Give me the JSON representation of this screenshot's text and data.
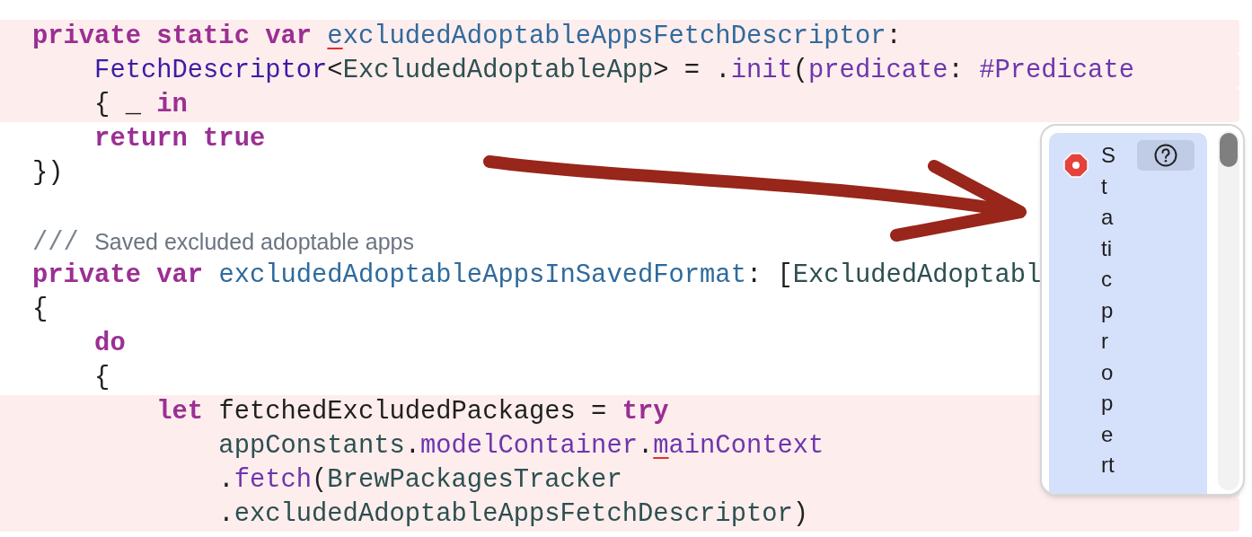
{
  "code_lines": [
    {
      "error": true,
      "tokens": [
        {
          "kind": "keyword",
          "text": "private static var "
        },
        {
          "kind": "decl-flag",
          "text": "e"
        },
        {
          "kind": "decl",
          "text": "xcludedAdoptableAppsFetchDescriptor"
        },
        {
          "kind": "plain",
          "text": ":"
        }
      ]
    },
    {
      "error": true,
      "tokens": [
        {
          "kind": "type",
          "text": "    FetchDescriptor"
        },
        {
          "kind": "plain",
          "text": "<"
        },
        {
          "kind": "project",
          "text": "ExcludedAdoptableApp"
        },
        {
          "kind": "plain",
          "text": "> = ."
        },
        {
          "kind": "member",
          "text": "init"
        },
        {
          "kind": "plain",
          "text": "("
        },
        {
          "kind": "member",
          "text": "predicate"
        },
        {
          "kind": "plain",
          "text": ": "
        },
        {
          "kind": "member",
          "text": "#Predicate"
        }
      ]
    },
    {
      "error": true,
      "tokens": [
        {
          "kind": "plain",
          "text": "    { _ "
        },
        {
          "kind": "keyword",
          "text": "in"
        }
      ]
    },
    {
      "error": false,
      "tokens": [
        {
          "kind": "keyword",
          "text": "    return true"
        }
      ]
    },
    {
      "error": false,
      "tokens": [
        {
          "kind": "plain",
          "text": "})"
        }
      ]
    },
    {
      "error": false
    },
    {
      "error": false,
      "tokens": [
        {
          "kind": "comment-marker",
          "text": "/// "
        },
        {
          "kind": "comment",
          "text": "Saved excluded adoptable apps"
        }
      ]
    },
    {
      "error": false,
      "tokens": [
        {
          "kind": "keyword",
          "text": "private var "
        },
        {
          "kind": "decl",
          "text": "excludedAdoptableAppsInSavedFormat"
        },
        {
          "kind": "plain",
          "text": ": ["
        },
        {
          "kind": "project",
          "text": "ExcludedAdoptabl"
        }
      ]
    },
    {
      "error": false,
      "tokens": [
        {
          "kind": "plain",
          "text": "{"
        }
      ]
    },
    {
      "error": false,
      "tokens": [
        {
          "kind": "keyword",
          "text": "    do"
        }
      ]
    },
    {
      "error": false,
      "tokens": [
        {
          "kind": "plain",
          "text": "    {"
        }
      ]
    },
    {
      "error": true,
      "tokens": [
        {
          "kind": "keyword",
          "text": "        let "
        },
        {
          "kind": "plain",
          "text": "fetchedExcludedPackages = "
        },
        {
          "kind": "keyword",
          "text": "try"
        }
      ]
    },
    {
      "error": true,
      "tokens": [
        {
          "kind": "project",
          "text": "            appConstants"
        },
        {
          "kind": "plain",
          "text": "."
        },
        {
          "kind": "member",
          "text": "modelContainer"
        },
        {
          "kind": "plain",
          "text": "."
        },
        {
          "kind": "member-flag",
          "text": "m"
        },
        {
          "kind": "member",
          "text": "ainContext"
        }
      ]
    },
    {
      "error": true,
      "tokens": [
        {
          "kind": "plain",
          "text": "            ."
        },
        {
          "kind": "member",
          "text": "fetch"
        },
        {
          "kind": "plain",
          "text": "("
        },
        {
          "kind": "project",
          "text": "BrewPackagesTracker"
        }
      ]
    },
    {
      "error": true,
      "tokens": [
        {
          "kind": "plain",
          "text": "            ."
        },
        {
          "kind": "project",
          "text": "excludedAdoptableAppsFetchDescriptor"
        },
        {
          "kind": "plain",
          "text": ")"
        }
      ]
    }
  ],
  "issue_popup": {
    "message_lines": [
      "S",
      "t",
      "a",
      "ti",
      "c",
      "p",
      "r",
      "o",
      "p",
      "e",
      "rt"
    ]
  }
}
